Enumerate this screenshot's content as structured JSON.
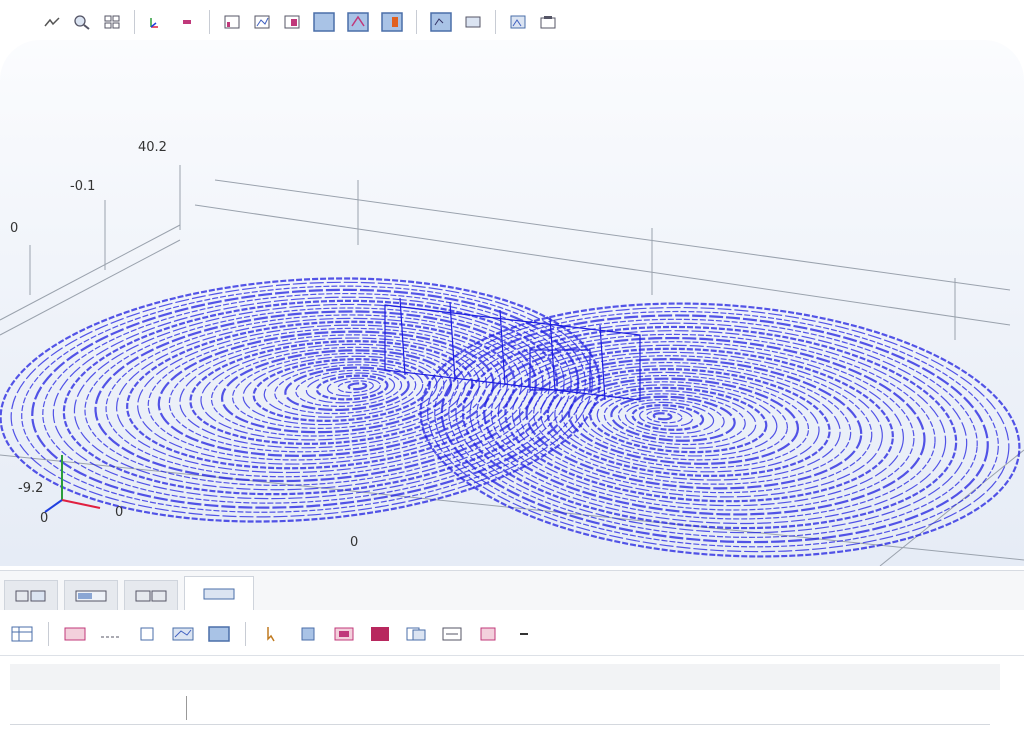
{
  "toolbar": {
    "icons": [
      "view-icon",
      "zoom-icon",
      "grid-icon",
      "axes-icon",
      "minus-icon",
      "plot-a-icon",
      "plot-b-icon",
      "plot-c-icon",
      "select-icon",
      "select-domain-icon",
      "select-boundary-icon",
      "screenshot-icon",
      "export-icon",
      "image-icon",
      "settings-icon"
    ]
  },
  "plot": {
    "title": "",
    "axis_labels": {
      "z_top": "40.2",
      "z_mid": "-0.1",
      "left": "0",
      "origin_z": "-9.2",
      "origin_x": "0",
      "bottom": "0",
      "right_origin": "0"
    },
    "line_color": "#1e1ee0"
  },
  "tabs": [
    {
      "name": "messages",
      "label": ""
    },
    {
      "name": "progress",
      "label": ""
    },
    {
      "name": "log",
      "label": ""
    },
    {
      "name": "results",
      "label": ""
    }
  ],
  "subtoolbar": {
    "icons": [
      "table-icon",
      "evaluate-icon",
      "format-icon",
      "export-table-icon",
      "graph-icon",
      "pointer-icon",
      "bars-icon",
      "color-table-icon",
      "color-fill-icon",
      "copy-icon",
      "paste-icon",
      "clear-icon",
      "dash-icon"
    ]
  },
  "status": {
    "text": ""
  },
  "input": {
    "prompt": "",
    "value": ""
  },
  "colors": {
    "accent": "#1e1ee0",
    "axis_x": "#e02040",
    "axis_y": "#2a9d3a",
    "axis_z": "#2040e0"
  }
}
